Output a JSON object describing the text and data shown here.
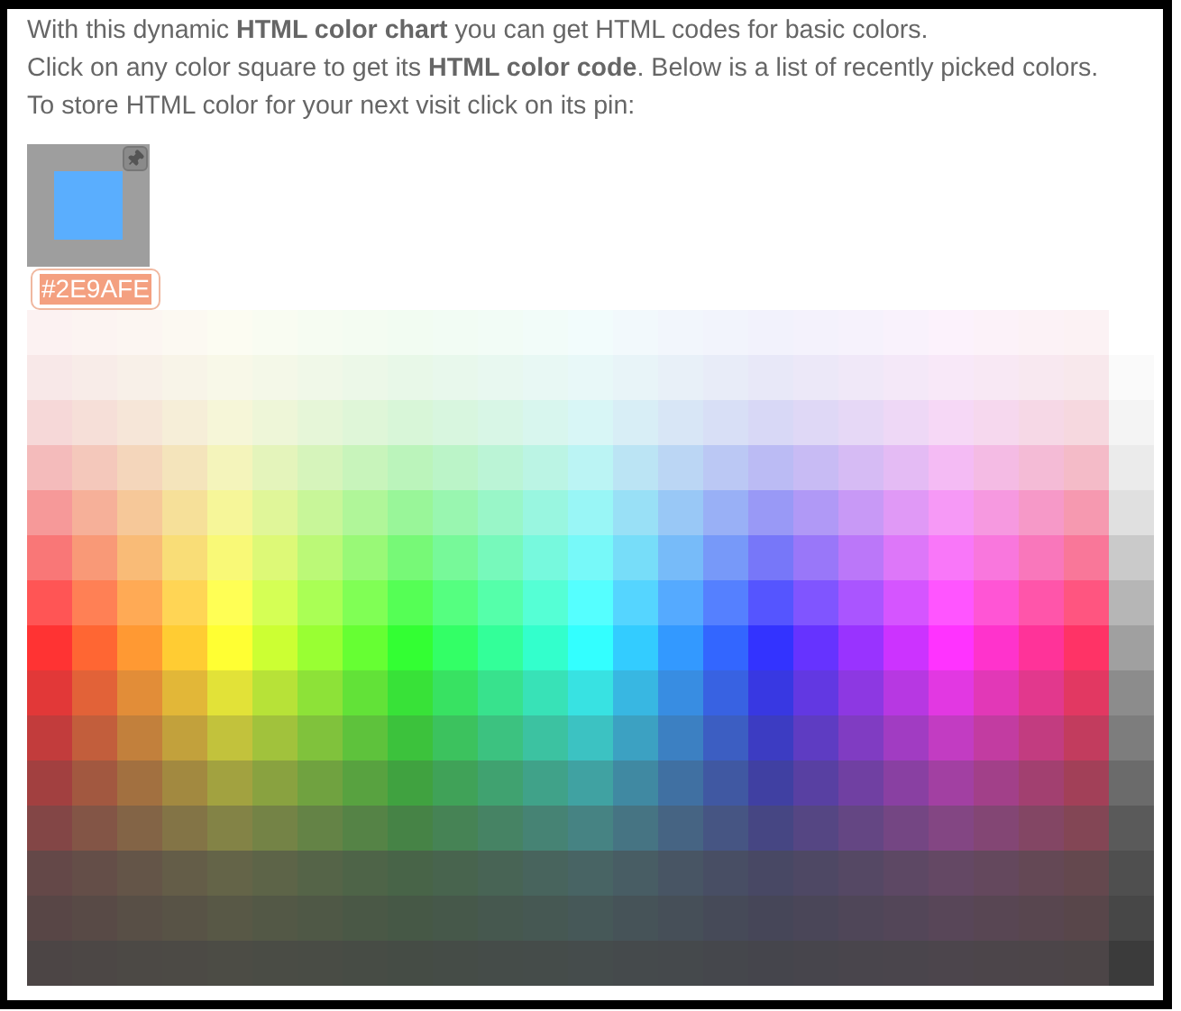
{
  "intro": [
    "With this dynamic **HTML color chart** you can get HTML codes for basic colors.",
    "Click on any color square to get its **HTML color code**. Below is a list of recently picked colors.",
    "To store HTML color for your next visit click on its pin:"
  ],
  "recent_colors": [
    {
      "color": "#5AAEFE",
      "code": "#2E9AFE",
      "code_selected": true
    }
  ],
  "color_rows": [
    {
      "squares": [
        {
          "color": "#FCF2F2"
        },
        {
          "color": "#FCF4F2"
        },
        {
          "color": "#FCF6F2"
        },
        {
          "color": "#FCF9F2"
        },
        {
          "color": "#FCFCF2"
        },
        {
          "color": "#F9FCF2"
        },
        {
          "color": "#F6FCF2"
        },
        {
          "color": "#F4FCF2"
        },
        {
          "color": "#F2FCF2"
        },
        {
          "color": "#F2FCF4"
        },
        {
          "color": "#F2FCF6"
        },
        {
          "color": "#F2FCF9"
        },
        {
          "color": "#F2FCFC"
        },
        {
          "color": "#F2F9FC"
        },
        {
          "color": "#F2F6FC"
        },
        {
          "color": "#F2F4FC"
        },
        {
          "color": "#F2F2FC"
        },
        {
          "color": "#F4F2FC"
        },
        {
          "color": "#F6F2FC"
        },
        {
          "color": "#F9F2FC"
        },
        {
          "color": "#FCF2FC"
        },
        {
          "color": "#FCF2F9"
        },
        {
          "color": "#FCF2F6"
        },
        {
          "color": "#FCF2F4"
        }
      ]
    },
    {
      "squares": [
        {
          "color": "#F8E8E8"
        },
        {
          "color": "#F8ECE8"
        },
        {
          "color": "#F8F0E8"
        },
        {
          "color": "#F8F4E8"
        },
        {
          "color": "#F8F8E8"
        },
        {
          "color": "#F4F8E8"
        },
        {
          "color": "#F0F8E8"
        },
        {
          "color": "#ECF8E8"
        },
        {
          "color": "#E8F8E8"
        },
        {
          "color": "#E8F8EC"
        },
        {
          "color": "#E8F8F0"
        },
        {
          "color": "#E8F8F4"
        },
        {
          "color": "#E8F8F8"
        },
        {
          "color": "#E8F4F8"
        },
        {
          "color": "#E8F0F8"
        },
        {
          "color": "#E8ECF8"
        },
        {
          "color": "#E8E8F8"
        },
        {
          "color": "#ECE8F8"
        },
        {
          "color": "#F0E8F8"
        },
        {
          "color": "#F4E8F8"
        },
        {
          "color": "#F8E8F8"
        },
        {
          "color": "#F8E8F4"
        },
        {
          "color": "#F8E8F0"
        },
        {
          "color": "#F8E8EC"
        },
        {
          "color": "#FAFAFA"
        }
      ]
    },
    {
      "squares": [
        {
          "color": "#F6D8D8"
        },
        {
          "color": "#F6DFD8"
        },
        {
          "color": "#F6E6D8"
        },
        {
          "color": "#F6EED8"
        },
        {
          "color": "#F6F6D8"
        },
        {
          "color": "#EEF6D8"
        },
        {
          "color": "#E6F6D8"
        },
        {
          "color": "#DFF6D8"
        },
        {
          "color": "#D8F6D8"
        },
        {
          "color": "#D8F6DF"
        },
        {
          "color": "#D8F6E6"
        },
        {
          "color": "#D8F6EE"
        },
        {
          "color": "#D8F6F6"
        },
        {
          "color": "#D8EEF6"
        },
        {
          "color": "#D8E6F6"
        },
        {
          "color": "#D8DFF6"
        },
        {
          "color": "#D8D8F6"
        },
        {
          "color": "#DFD8F6"
        },
        {
          "color": "#E6D8F6"
        },
        {
          "color": "#EED8F6"
        },
        {
          "color": "#F6D8F6"
        },
        {
          "color": "#F6D8EE"
        },
        {
          "color": "#F6D8E6"
        },
        {
          "color": "#F6D8DF"
        },
        {
          "color": "#F4F4F4"
        }
      ]
    },
    {
      "squares": [
        {
          "color": "#F4BBBB"
        },
        {
          "color": "#F4C8BB"
        },
        {
          "color": "#F4D6BB"
        },
        {
          "color": "#F4E4BB"
        },
        {
          "color": "#F4F4BB"
        },
        {
          "color": "#E4F4BB"
        },
        {
          "color": "#D6F4BB"
        },
        {
          "color": "#C8F4BB"
        },
        {
          "color": "#BBF4BB"
        },
        {
          "color": "#BBF4C8"
        },
        {
          "color": "#BBF4D6"
        },
        {
          "color": "#BBF4E4"
        },
        {
          "color": "#BBF4F4"
        },
        {
          "color": "#BBE4F4"
        },
        {
          "color": "#BBD6F4"
        },
        {
          "color": "#BBC8F4"
        },
        {
          "color": "#BBBBF4"
        },
        {
          "color": "#C8BBF4"
        },
        {
          "color": "#D6BBF4"
        },
        {
          "color": "#E4BBF4"
        },
        {
          "color": "#F4BBF4"
        },
        {
          "color": "#F4BBE4"
        },
        {
          "color": "#F4BBD6"
        },
        {
          "color": "#F4BBC8"
        },
        {
          "color": "#EBEBEB"
        }
      ]
    },
    {
      "squares": [
        {
          "color": "#F69999"
        },
        {
          "color": "#F6B099"
        },
        {
          "color": "#F6C899"
        },
        {
          "color": "#F6E099"
        },
        {
          "color": "#F6F699"
        },
        {
          "color": "#E0F699"
        },
        {
          "color": "#C8F699"
        },
        {
          "color": "#B0F699"
        },
        {
          "color": "#99F699"
        },
        {
          "color": "#99F6B0"
        },
        {
          "color": "#99F6C8"
        },
        {
          "color": "#99F6E0"
        },
        {
          "color": "#99F6F6"
        },
        {
          "color": "#99E0F6"
        },
        {
          "color": "#99C8F6"
        },
        {
          "color": "#99B0F6"
        },
        {
          "color": "#9999F6"
        },
        {
          "color": "#B099F6"
        },
        {
          "color": "#C899F6"
        },
        {
          "color": "#E099F6"
        },
        {
          "color": "#F699F6"
        },
        {
          "color": "#F699E0"
        },
        {
          "color": "#F699C8"
        },
        {
          "color": "#F699B0"
        },
        {
          "color": "#E0E0E0"
        }
      ]
    },
    {
      "squares": [
        {
          "color": "#F97777"
        },
        {
          "color": "#F99977"
        },
        {
          "color": "#F9BB77"
        },
        {
          "color": "#F9DD77"
        },
        {
          "color": "#F9F977"
        },
        {
          "color": "#DDF977"
        },
        {
          "color": "#BBF977"
        },
        {
          "color": "#99F977"
        },
        {
          "color": "#77F977"
        },
        {
          "color": "#77F999"
        },
        {
          "color": "#77F9BB"
        },
        {
          "color": "#77F9DD"
        },
        {
          "color": "#77F9F9"
        },
        {
          "color": "#77DDF9"
        },
        {
          "color": "#77BBF9"
        },
        {
          "color": "#7799F9"
        },
        {
          "color": "#7777F9"
        },
        {
          "color": "#9977F9"
        },
        {
          "color": "#BB77F9"
        },
        {
          "color": "#DD77F9"
        },
        {
          "color": "#F977F9"
        },
        {
          "color": "#F977DD"
        },
        {
          "color": "#F977BB"
        },
        {
          "color": "#F97799"
        },
        {
          "color": "#CACACA"
        }
      ]
    },
    {
      "squares": [
        {
          "color": "#FF5555"
        },
        {
          "color": "#FF8055"
        },
        {
          "color": "#FFAA55"
        },
        {
          "color": "#FFD555"
        },
        {
          "color": "#FFFF55"
        },
        {
          "color": "#D5FF55"
        },
        {
          "color": "#AAFF55"
        },
        {
          "color": "#80FF55"
        },
        {
          "color": "#55FF55"
        },
        {
          "color": "#55FF80"
        },
        {
          "color": "#55FFAA"
        },
        {
          "color": "#55FFD5"
        },
        {
          "color": "#55FFFF"
        },
        {
          "color": "#55D5FF"
        },
        {
          "color": "#55AAFF"
        },
        {
          "color": "#5580FF"
        },
        {
          "color": "#5555FF"
        },
        {
          "color": "#8055FF"
        },
        {
          "color": "#AA55FF"
        },
        {
          "color": "#D555FF"
        },
        {
          "color": "#FF55FF"
        },
        {
          "color": "#FF55D5"
        },
        {
          "color": "#FF55AA"
        },
        {
          "color": "#FF5580"
        },
        {
          "color": "#B6B6B6"
        }
      ]
    },
    {
      "squares": [
        {
          "color": "#FF3333"
        },
        {
          "color": "#FF6633"
        },
        {
          "color": "#FF9933"
        },
        {
          "color": "#FFCC33"
        },
        {
          "color": "#FFFF33"
        },
        {
          "color": "#CCFF33"
        },
        {
          "color": "#99FF33"
        },
        {
          "color": "#66FF33"
        },
        {
          "color": "#33FF33"
        },
        {
          "color": "#33FF66"
        },
        {
          "color": "#33FF99"
        },
        {
          "color": "#33FFCC"
        },
        {
          "color": "#33FFFF"
        },
        {
          "color": "#33CCFF"
        },
        {
          "color": "#3399FF"
        },
        {
          "color": "#3366FF"
        },
        {
          "color": "#3333FF"
        },
        {
          "color": "#6633FF"
        },
        {
          "color": "#9933FF"
        },
        {
          "color": "#CC33FF"
        },
        {
          "color": "#FF33FF"
        },
        {
          "color": "#FF33CC"
        },
        {
          "color": "#FF3399"
        },
        {
          "color": "#FF3366"
        },
        {
          "color": "#A0A0A0"
        }
      ]
    },
    {
      "squares": [
        {
          "color": "#E23838"
        },
        {
          "color": "#E26238"
        },
        {
          "color": "#E28D38"
        },
        {
          "color": "#E2B738"
        },
        {
          "color": "#E2E238"
        },
        {
          "color": "#B7E238"
        },
        {
          "color": "#8DE238"
        },
        {
          "color": "#62E238"
        },
        {
          "color": "#38E238"
        },
        {
          "color": "#38E262"
        },
        {
          "color": "#38E28D"
        },
        {
          "color": "#38E2B7"
        },
        {
          "color": "#38E2E2"
        },
        {
          "color": "#38B7E2"
        },
        {
          "color": "#388DE2"
        },
        {
          "color": "#3862E2"
        },
        {
          "color": "#3838E2"
        },
        {
          "color": "#6238E2"
        },
        {
          "color": "#8D38E2"
        },
        {
          "color": "#B738E2"
        },
        {
          "color": "#E238E2"
        },
        {
          "color": "#E238B7"
        },
        {
          "color": "#E2388D"
        },
        {
          "color": "#E23862"
        },
        {
          "color": "#8C8C8C"
        }
      ]
    },
    {
      "squares": [
        {
          "color": "#C23C3C"
        },
        {
          "color": "#C25E3C"
        },
        {
          "color": "#C2803C"
        },
        {
          "color": "#C2A13C"
        },
        {
          "color": "#C2C23C"
        },
        {
          "color": "#A1C23C"
        },
        {
          "color": "#80C23C"
        },
        {
          "color": "#5EC23C"
        },
        {
          "color": "#3CC23C"
        },
        {
          "color": "#3CC25E"
        },
        {
          "color": "#3CC280"
        },
        {
          "color": "#3CC2A1"
        },
        {
          "color": "#3CC2C2"
        },
        {
          "color": "#3CA1C2"
        },
        {
          "color": "#3C80C2"
        },
        {
          "color": "#3C5EC2"
        },
        {
          "color": "#3C3CC2"
        },
        {
          "color": "#5E3CC2"
        },
        {
          "color": "#803CC2"
        },
        {
          "color": "#A13CC2"
        },
        {
          "color": "#C23CC2"
        },
        {
          "color": "#C23CA1"
        },
        {
          "color": "#C23C80"
        },
        {
          "color": "#C23C5E"
        },
        {
          "color": "#7D7D7D"
        }
      ]
    },
    {
      "squares": [
        {
          "color": "#A24040"
        },
        {
          "color": "#A25840"
        },
        {
          "color": "#A27040"
        },
        {
          "color": "#A28940"
        },
        {
          "color": "#A2A240"
        },
        {
          "color": "#89A240"
        },
        {
          "color": "#70A240"
        },
        {
          "color": "#58A240"
        },
        {
          "color": "#40A240"
        },
        {
          "color": "#40A258"
        },
        {
          "color": "#40A270"
        },
        {
          "color": "#40A289"
        },
        {
          "color": "#40A2A2"
        },
        {
          "color": "#4089A2"
        },
        {
          "color": "#4070A2"
        },
        {
          "color": "#4058A2"
        },
        {
          "color": "#4040A2"
        },
        {
          "color": "#5840A2"
        },
        {
          "color": "#7040A2"
        },
        {
          "color": "#8940A2"
        },
        {
          "color": "#A240A2"
        },
        {
          "color": "#A24089"
        },
        {
          "color": "#A24070"
        },
        {
          "color": "#A24058"
        },
        {
          "color": "#6B6B6B"
        }
      ]
    },
    {
      "squares": [
        {
          "color": "#834646"
        },
        {
          "color": "#835546"
        },
        {
          "color": "#836446"
        },
        {
          "color": "#837446"
        },
        {
          "color": "#838346"
        },
        {
          "color": "#748346"
        },
        {
          "color": "#648346"
        },
        {
          "color": "#558346"
        },
        {
          "color": "#468346"
        },
        {
          "color": "#468355"
        },
        {
          "color": "#468364"
        },
        {
          "color": "#468374"
        },
        {
          "color": "#468383"
        },
        {
          "color": "#467483"
        },
        {
          "color": "#466483"
        },
        {
          "color": "#465583"
        },
        {
          "color": "#464683"
        },
        {
          "color": "#554683"
        },
        {
          "color": "#644683"
        },
        {
          "color": "#744683"
        },
        {
          "color": "#834683"
        },
        {
          "color": "#834674"
        },
        {
          "color": "#834664"
        },
        {
          "color": "#834655"
        },
        {
          "color": "#5A5A5A"
        }
      ]
    },
    {
      "squares": [
        {
          "color": "#644848"
        },
        {
          "color": "#644E48"
        },
        {
          "color": "#645548"
        },
        {
          "color": "#645D48"
        },
        {
          "color": "#646448"
        },
        {
          "color": "#5D6448"
        },
        {
          "color": "#556448"
        },
        {
          "color": "#4E6448"
        },
        {
          "color": "#486448"
        },
        {
          "color": "#48644E"
        },
        {
          "color": "#486455"
        },
        {
          "color": "#48645D"
        },
        {
          "color": "#486464"
        },
        {
          "color": "#485D64"
        },
        {
          "color": "#485564"
        },
        {
          "color": "#484E64"
        },
        {
          "color": "#484864"
        },
        {
          "color": "#4E4864"
        },
        {
          "color": "#554864"
        },
        {
          "color": "#5D4864"
        },
        {
          "color": "#644864"
        },
        {
          "color": "#64485D"
        },
        {
          "color": "#644855"
        },
        {
          "color": "#64484E"
        },
        {
          "color": "#4F4F4F"
        }
      ]
    },
    {
      "squares": [
        {
          "color": "#584646"
        },
        {
          "color": "#584A46"
        },
        {
          "color": "#584F46"
        },
        {
          "color": "#585346"
        },
        {
          "color": "#585846"
        },
        {
          "color": "#535846"
        },
        {
          "color": "#4F5846"
        },
        {
          "color": "#4A5846"
        },
        {
          "color": "#465846"
        },
        {
          "color": "#46584A"
        },
        {
          "color": "#46584F"
        },
        {
          "color": "#465853"
        },
        {
          "color": "#465858"
        },
        {
          "color": "#465358"
        },
        {
          "color": "#464F58"
        },
        {
          "color": "#464A58"
        },
        {
          "color": "#464658"
        },
        {
          "color": "#4A4658"
        },
        {
          "color": "#4F4658"
        },
        {
          "color": "#534658"
        },
        {
          "color": "#584658"
        },
        {
          "color": "#584653"
        },
        {
          "color": "#58464F"
        },
        {
          "color": "#58464A"
        },
        {
          "color": "#474747"
        }
      ]
    },
    {
      "squares": [
        {
          "color": "#4C4545"
        },
        {
          "color": "#4C4745"
        },
        {
          "color": "#4C4945"
        },
        {
          "color": "#4C4A45"
        },
        {
          "color": "#4C4C45"
        },
        {
          "color": "#4A4C45"
        },
        {
          "color": "#494C45"
        },
        {
          "color": "#474C45"
        },
        {
          "color": "#454C45"
        },
        {
          "color": "#454C47"
        },
        {
          "color": "#454C49"
        },
        {
          "color": "#454C4A"
        },
        {
          "color": "#454C4C"
        },
        {
          "color": "#454A4C"
        },
        {
          "color": "#45494C"
        },
        {
          "color": "#45474C"
        },
        {
          "color": "#45454C"
        },
        {
          "color": "#47454C"
        },
        {
          "color": "#49454C"
        },
        {
          "color": "#4A454C"
        },
        {
          "color": "#4C454C"
        },
        {
          "color": "#4C454A"
        },
        {
          "color": "#4C4549"
        },
        {
          "color": "#4C4547"
        },
        {
          "color": "#3B3B3B"
        }
      ]
    }
  ]
}
